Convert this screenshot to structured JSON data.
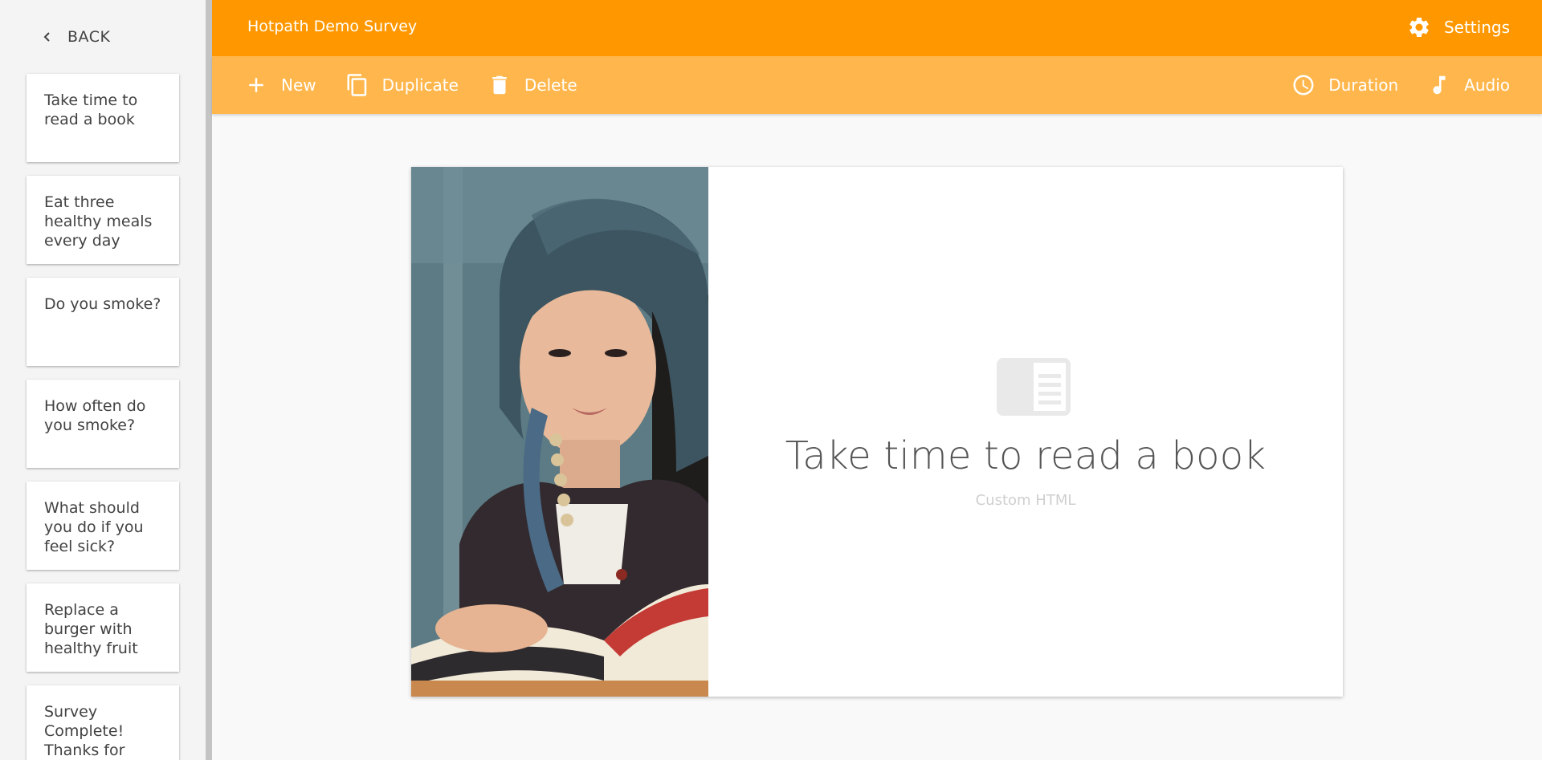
{
  "sidebar": {
    "back_label": "BACK",
    "items": [
      {
        "label": "Take time to read a book"
      },
      {
        "label": "Eat three healthy meals every day"
      },
      {
        "label": "Do you smoke?"
      },
      {
        "label": "How often do you smoke?"
      },
      {
        "label": "What should you do if you feel sick?"
      },
      {
        "label": "Replace a burger with healthy fruit"
      },
      {
        "label": "Survey Complete! Thanks for"
      }
    ]
  },
  "header": {
    "title": "Hotpath Demo Survey",
    "settings_label": "Settings",
    "icon": "gear-icon"
  },
  "toolbar": {
    "new_label": "New",
    "duplicate_label": "Duplicate",
    "delete_label": "Delete",
    "duration_label": "Duration",
    "audio_label": "Audio",
    "icons": [
      "plus-icon",
      "copy-icon",
      "trash-icon",
      "clock-icon",
      "music-note-icon"
    ]
  },
  "slide": {
    "title": "Take time to read a book",
    "subtitle": "Custom HTML",
    "icon": "article-icon",
    "image": "woman-reading-book-photo"
  },
  "colors": {
    "header_bg": "#ff9800",
    "toolbar_bg": "#ffb74d",
    "sidebar_bg": "#f4f4f4"
  }
}
